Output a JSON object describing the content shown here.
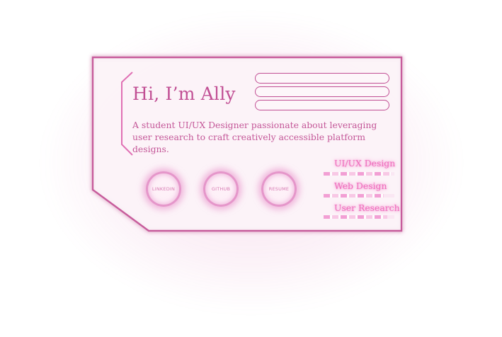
{
  "profile": {
    "greeting": "Hi, I’m Ally",
    "bio": "A student UI/UX Designer passionate about leveraging user research to craft creatively accessible platform designs."
  },
  "links": [
    {
      "label": "LINKEDIN"
    },
    {
      "label": "GITHUB"
    },
    {
      "label": "RESUME"
    }
  ],
  "skills": [
    {
      "label": "UI/UX Design",
      "level": 0.95
    },
    {
      "label": "Web Design",
      "level": 0.85
    },
    {
      "label": "User Research",
      "level": 0.9
    }
  ],
  "menu_pills": 3,
  "colors": {
    "accent": "#c14f94",
    "glow": "#ef6fbd",
    "card_fill": "#fcf3f8"
  },
  "icons": {
    "bracket": "left-bracket-decoration"
  }
}
